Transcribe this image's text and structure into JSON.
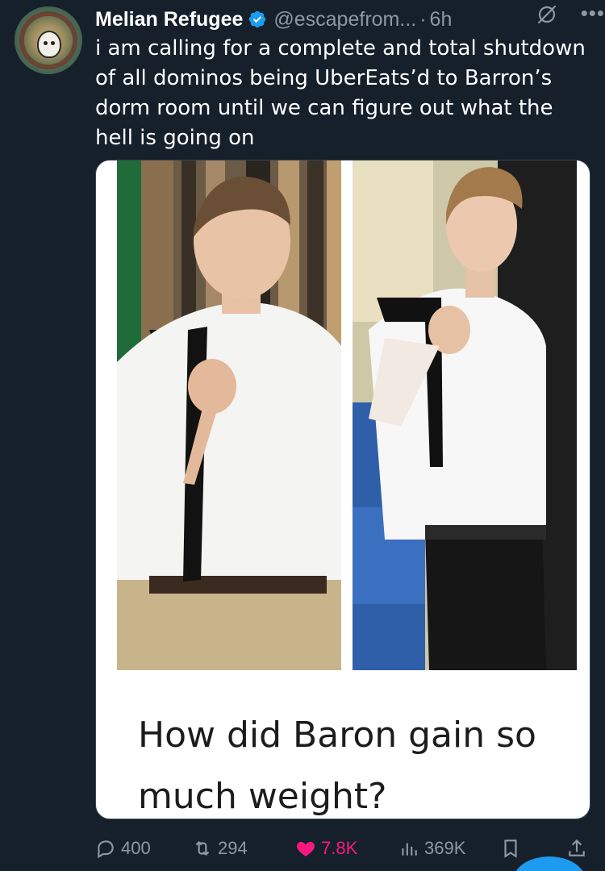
{
  "author": {
    "name": "Melian Refugee",
    "handle": "@escapefrom...",
    "separator": "·",
    "time": "6h",
    "verified": true
  },
  "tweet": {
    "text": "i am calling for a complete and total shutdown of all  dominos being UberEats’d to Barron’s dorm room until we can figure out what the hell is going on"
  },
  "media": {
    "caption": "How did Baron gain so much weight?",
    "photo_left_desc_icon": "person-photo",
    "photo_right_desc_icon": "person-photo"
  },
  "actions": {
    "replies": "400",
    "reposts": "294",
    "likes": "7.8K",
    "views": "369K"
  },
  "colors": {
    "background": "#15202b",
    "secondary_text": "#8b98a5",
    "like": "#f91880",
    "verified": "#1d9bf0"
  }
}
